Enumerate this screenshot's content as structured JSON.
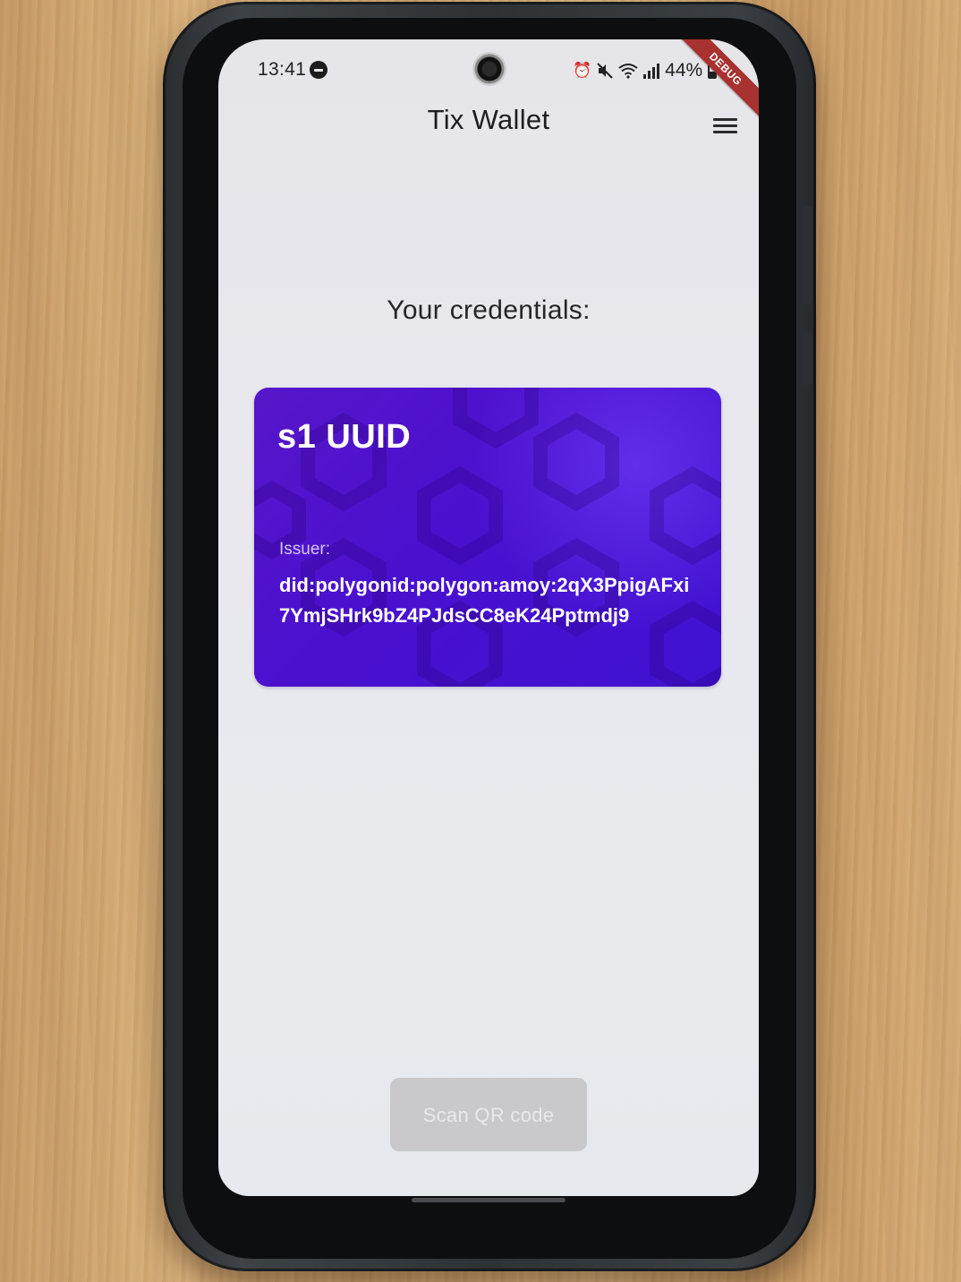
{
  "status_bar": {
    "time": "13:41",
    "battery": "44%",
    "icons": [
      "do-not-disturb-icon",
      "alarm-icon",
      "mute-icon",
      "wifi-icon",
      "signal-icon",
      "battery-icon"
    ]
  },
  "debug_banner": "DEBUG",
  "app_bar": {
    "title": "Tix Wallet",
    "menu_icon": "hamburger-menu-icon"
  },
  "main": {
    "heading": "Your credentials:",
    "credentials": [
      {
        "title": "s1 UUID",
        "issuer_label": "Issuer:",
        "issuer": "did:polygonid:polygon:amoy:2qX3PpigAFxi7YmjSHrk9bZ4PJdsCC8eK24Pptmdj9"
      }
    ]
  },
  "scan_button": {
    "label": "Scan QR code"
  },
  "colors": {
    "card_primary": "#4a10cf",
    "screen_background": "#e8e8ee",
    "button_disabled": "#c9c9cc",
    "debug_banner": "#a8322f"
  }
}
